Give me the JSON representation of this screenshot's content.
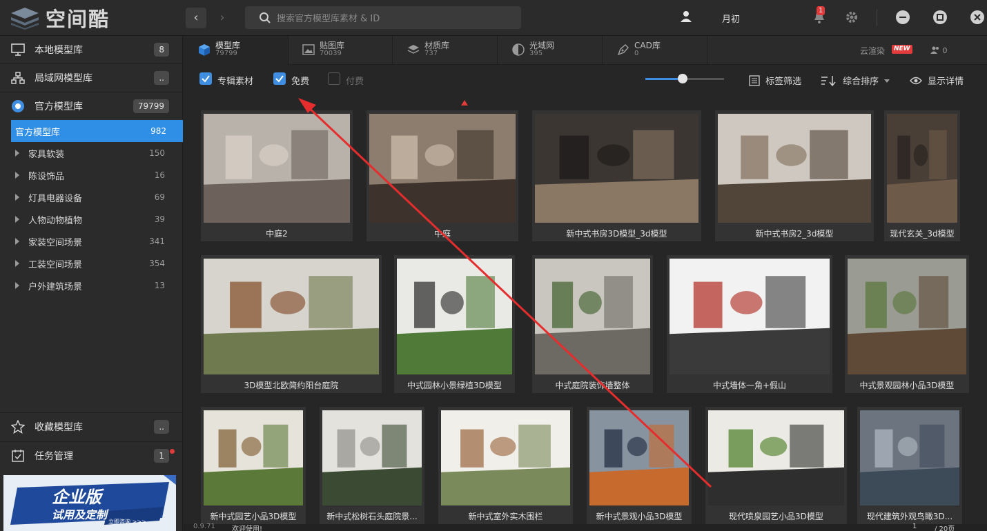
{
  "app": {
    "name": "空间酷"
  },
  "search": {
    "placeholder": "搜索官方模型库素材 & ID"
  },
  "user": {
    "name": "月初",
    "notifications": "1"
  },
  "sidebar": {
    "local": {
      "label": "本地模型库",
      "count": "8"
    },
    "lan": {
      "label": "局域网模型库",
      "count": ".."
    },
    "official": {
      "label": "官方模型库",
      "count": "79799"
    },
    "active_category": {
      "label": "官方模型库",
      "count": "982"
    },
    "categories": [
      {
        "label": "家具软装",
        "count": "150"
      },
      {
        "label": "陈设饰品",
        "count": "16"
      },
      {
        "label": "灯具电器设备",
        "count": "69"
      },
      {
        "label": "人物动物植物",
        "count": "39"
      },
      {
        "label": "家装空间场景",
        "count": "341"
      },
      {
        "label": "工装空间场景",
        "count": "354"
      },
      {
        "label": "户外建筑场景",
        "count": "13"
      }
    ],
    "favorites": {
      "label": "收藏模型库",
      "count": ".."
    },
    "tasks": {
      "label": "任务管理",
      "count": "1"
    },
    "ad": {
      "title": "企业版",
      "subtitle": "试用及定制",
      "cta": "立即咨询 >>>"
    }
  },
  "tabs": [
    {
      "label": "模型库",
      "count": "79799"
    },
    {
      "label": "贴图库",
      "count": "70039"
    },
    {
      "label": "材质库",
      "count": "737"
    },
    {
      "label": "光域网",
      "count": "395"
    },
    {
      "label": "CAD库",
      "count": "0"
    }
  ],
  "topright": {
    "cloud": "云渲染",
    "new": "NEW",
    "friends": "0"
  },
  "filters": {
    "album": "专辑素材",
    "free": "免费",
    "paid": "付费",
    "tag_filter": "标签筛选",
    "sort": "综合排序",
    "details": "显示详情",
    "zoom": 0.47
  },
  "cards": [
    {
      "caption": "中庭2"
    },
    {
      "caption": "中庭"
    },
    {
      "caption": "新中式书房3D模型_3d模型"
    },
    {
      "caption": "新中式书房2_3d模型"
    },
    {
      "caption": "现代玄关_3d模型"
    },
    {
      "caption": "3D模型北欧简约阳台庭院"
    },
    {
      "caption": "中式园林小景绿植3D模型"
    },
    {
      "caption": "中式庭院装饰墙整体"
    },
    {
      "caption": "中式墙体一角+假山"
    },
    {
      "caption": "中式景观园林小品3D模型"
    },
    {
      "caption": "新中式园艺小品3D模型"
    },
    {
      "caption": "新中式松树石头庭院景..."
    },
    {
      "caption": "新中式室外实木围栏"
    },
    {
      "caption": "新中式景观小品3D模型"
    },
    {
      "caption": "现代喷泉园艺小品3D模型"
    },
    {
      "caption": "现代建筑外观鸟瞰3D..."
    }
  ],
  "status": {
    "version": "0.9.71",
    "message": "欢迎使用!",
    "page": "1",
    "total": "/ 20页"
  },
  "colors": {
    "accent": "#2f8ee6",
    "bg": "#262626",
    "panel": "#2b2b2b",
    "red": "#e23b3b"
  }
}
